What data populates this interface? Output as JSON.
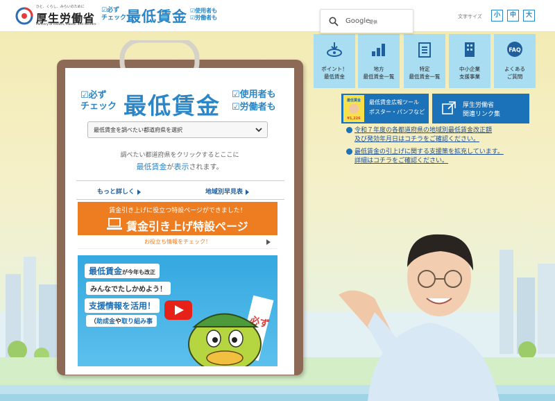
{
  "header": {
    "ministry_tagline": "ひと、くらし、みらいのために",
    "ministry_name": "厚生労働省",
    "ministry_en": "Ministry of Health, Labour and Welfare",
    "site_logo": {
      "check1": "必ず",
      "check2": "チェック",
      "title": "最低賃金",
      "right1": "使用者も",
      "right2": "労働者も"
    },
    "search": {
      "brand": "Google",
      "suffix": "提供"
    },
    "font_size": {
      "label": "文字サイズ",
      "small": "小",
      "medium": "中",
      "large": "大"
    }
  },
  "clipboard": {
    "logo": {
      "check1": "必ず",
      "check2": "チェック",
      "title": "最低賃金",
      "right1": "使用者も",
      "right2": "労働者も"
    },
    "select_value": "最低賃金を調べたい都道府県を選択",
    "hint_line1": "調べたい都道府県をクリックするとここに",
    "hint_line2_a": "最低賃金",
    "hint_line2_b": "が",
    "hint_line2_c": "表示",
    "hint_line2_d": "されます。",
    "link_more": "もっと詳しく",
    "link_regional": "地域別早見表",
    "special_banner": {
      "line1": "賃金引き上げに役立つ特設ページができました！",
      "line2": "賃金引き上げ特設ページ",
      "line3": "お役立ち情報をチェック！"
    },
    "video_banner": {
      "t1a": "最低賃金",
      "t1b": "が今年も改正",
      "t2": "みんなでたしかめよう！",
      "t3": "支援情報を活用！",
      "t4a": "（",
      "t4b": "助成金",
      "t4c": "や",
      "t4d": "取り組み事",
      "side": "必ず"
    }
  },
  "nav_cards": [
    {
      "line1": "ポイント！",
      "line2": "最低賃金"
    },
    {
      "line1": "地方",
      "line2": "最低賃金一覧"
    },
    {
      "line1": "特定",
      "line2": "最低賃金一覧"
    },
    {
      "line1": "中小企業",
      "line2": "支援事業"
    },
    {
      "line1": "よくある",
      "line2": "ご質問"
    }
  ],
  "nav_icon_faq": "FAQ",
  "promo": {
    "poster_line1": "最低賃金広報ツール",
    "poster_line2": "ポスター・パンフなど",
    "poster_thumb_title": "最低賃金",
    "poster_thumb_value": "¥1,226",
    "related_line1": "厚生労働省",
    "related_line2": "関連リンク集"
  },
  "notices": [
    {
      "line1": "令和７年度の各都道府県の地域別最低賃金改正額",
      "line2": "及び発効年月日はコチラをご確認ください。"
    },
    {
      "line1": "最低賃金の引上げに関する支援策を拡充しています。",
      "line2": "詳細はコチラをご確認ください。"
    }
  ],
  "colors": {
    "brand_blue": "#2a86c6",
    "nav_card": "#a9ddf2",
    "promo_blue": "#1c72b8",
    "banner_orange": "#ee7d22",
    "clipboard_brown": "#8c6a55"
  }
}
